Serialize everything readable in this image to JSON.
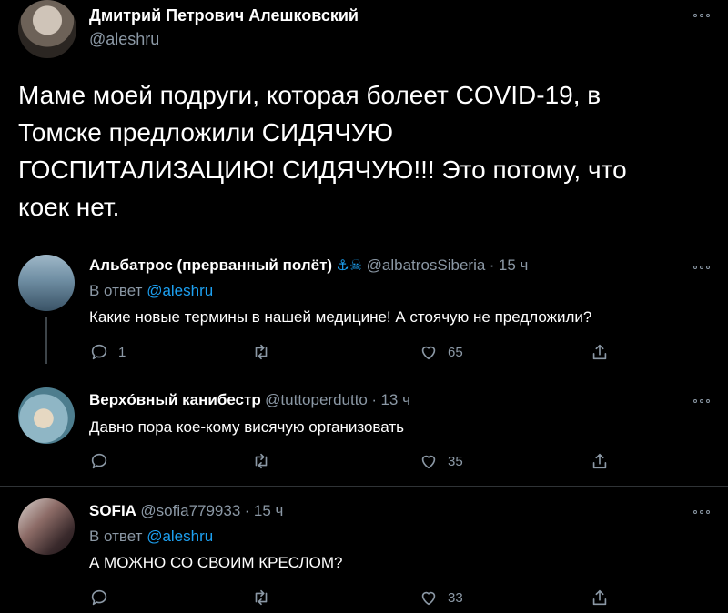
{
  "main_tweet": {
    "author_name": "Дмитрий Петрович Алешковский",
    "handle": "@aleshru",
    "text": "Маме моей подруги, которая болеет COVID-19, в Томске предложили СИДЯЧУЮ ГОСПИТАЛИЗАЦИЮ! СИДЯЧУЮ!!! Это потому, что коек нет."
  },
  "replies": [
    {
      "author_name": "Альбатрос (прерванный полёт)",
      "emoji": "⚓☠",
      "handle": "@albatrosSiberia",
      "dot": "·",
      "time": "15 ч",
      "reply_prefix": "В ответ",
      "reply_to": "@aleshru",
      "text": "Какие новые термины в нашей медицине! А стоячую не предложили?",
      "reply_count": "1",
      "like_count": "65"
    },
    {
      "author_name": "Верхóвный канибестр",
      "handle": "@tuttoperdutto",
      "dot": "·",
      "time": "13 ч",
      "text": "Давно пора кое-кому висячую организовать",
      "reply_count": "",
      "like_count": "35"
    },
    {
      "author_name": "SOFIA",
      "handle": "@sofia779933",
      "dot": "·",
      "time": "15 ч",
      "reply_prefix": "В ответ",
      "reply_to": "@aleshru",
      "text": "А МОЖНО СО СВОИМ КРЕСЛОМ?",
      "reply_count": "",
      "like_count": "33"
    }
  ],
  "colors": {
    "background": "#000000",
    "muted": "#8b98a5",
    "link": "#1da1f2",
    "divider": "#2f3336"
  }
}
